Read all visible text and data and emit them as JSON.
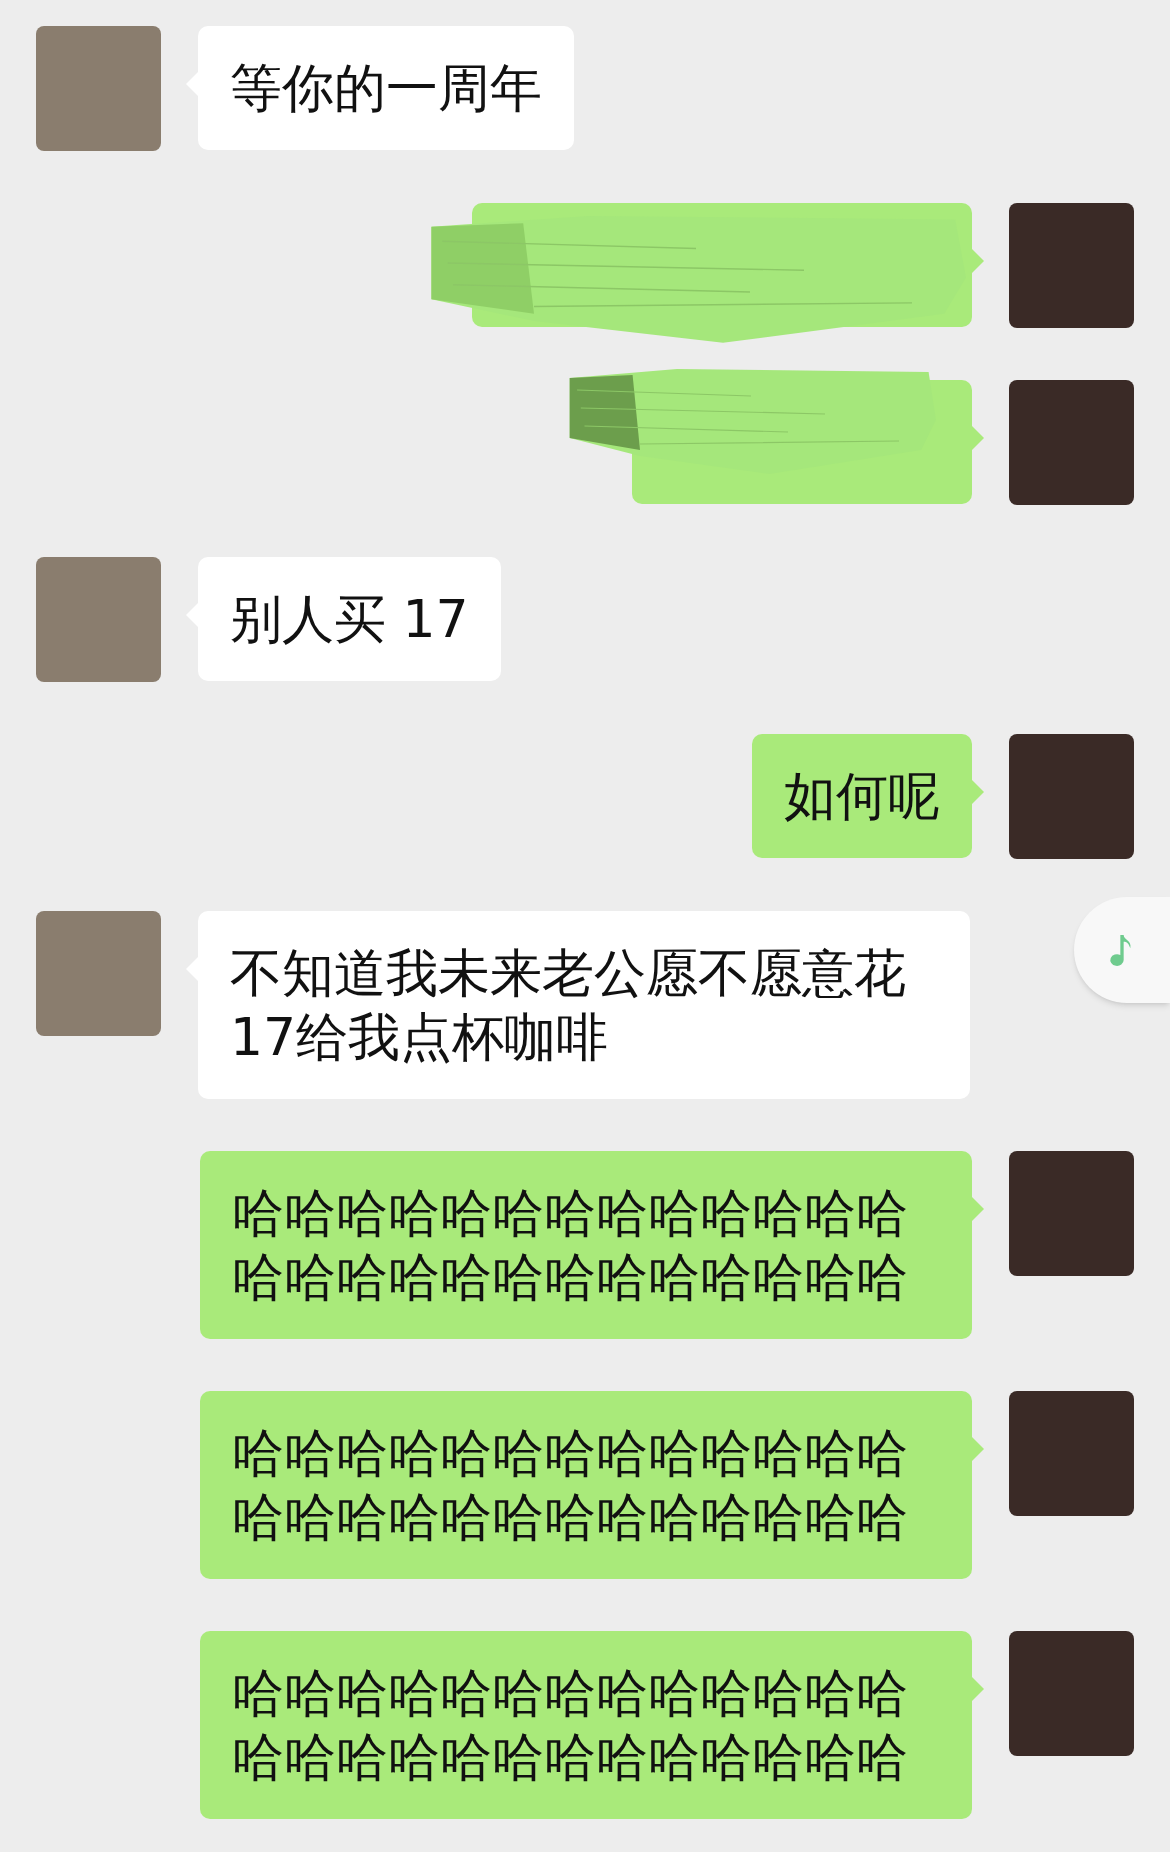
{
  "messages": [
    {
      "outgoing": false,
      "kind": "text",
      "text": "等你的一周年"
    },
    {
      "outgoing": true,
      "kind": "redacted"
    },
    {
      "outgoing": true,
      "kind": "redacted"
    },
    {
      "outgoing": false,
      "kind": "text",
      "text": "别人买 17"
    },
    {
      "outgoing": true,
      "kind": "text",
      "text": "如何呢"
    },
    {
      "outgoing": false,
      "kind": "text",
      "text": "不知道我未来老公愿不愿意花17给我点杯咖啡"
    },
    {
      "outgoing": true,
      "kind": "text",
      "text": "哈哈哈哈哈哈哈哈哈哈哈哈哈哈哈哈哈哈哈哈哈哈哈哈哈哈"
    },
    {
      "outgoing": true,
      "kind": "text",
      "text": "哈哈哈哈哈哈哈哈哈哈哈哈哈哈哈哈哈哈哈哈哈哈哈哈哈哈"
    },
    {
      "outgoing": true,
      "kind": "text",
      "text": "哈哈哈哈哈哈哈哈哈哈哈哈哈哈哈哈哈哈哈哈哈哈哈哈哈哈"
    }
  ]
}
